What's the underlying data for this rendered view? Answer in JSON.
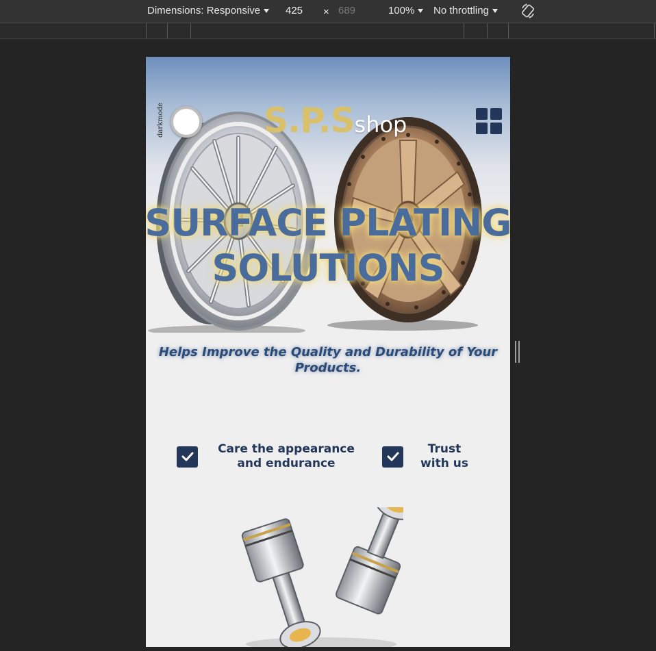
{
  "devtools": {
    "dimensions_label": "Dimensions: Responsive",
    "width": "425",
    "times": "×",
    "height": "689",
    "zoom": "100%",
    "throttling": "No throttling"
  },
  "page": {
    "darkmode_label": "darkmode",
    "logo": {
      "main": "S.P.S",
      "suffix": "shop"
    },
    "hero": {
      "title": "SURFACE PLATING SOLUTIONS",
      "subtitle": "Helps Improve the Quality and Durability of Your Products."
    },
    "features": [
      {
        "label": "Care the appearance and endurance"
      },
      {
        "label": "Trust with us"
      }
    ]
  },
  "colors": {
    "logo_gold": "#d9c06a",
    "title_blue": "#4a6c9c",
    "accent_navy": "#22375a",
    "devtools_bg": "#333333",
    "page_bg": "#efeff0"
  },
  "icons": {
    "dropdown": "caret-down-icon",
    "close": "x-icon",
    "rotate": "rotate-device-icon",
    "menu": "grid-menu-icon",
    "check": "checkbox-check-icon"
  }
}
